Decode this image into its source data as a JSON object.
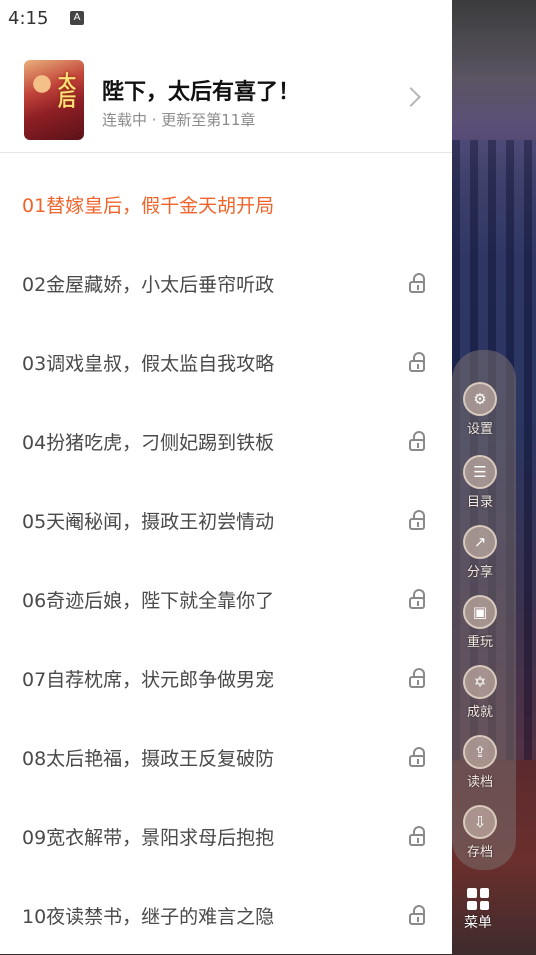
{
  "status_bar": {
    "time": "4:15",
    "notification_badge": "A"
  },
  "book": {
    "title": "陛下，太后有喜了！",
    "status": "连载中 · 更新至第11章"
  },
  "chapters": [
    {
      "title": "01替嫁皇后，假千金天胡开局",
      "locked": false,
      "active": true
    },
    {
      "title": "02金屋藏娇，小太后垂帘听政",
      "locked": true,
      "active": false
    },
    {
      "title": "03调戏皇叔，假太监自我攻略",
      "locked": true,
      "active": false
    },
    {
      "title": "04扮猪吃虎，刁侧妃踢到铁板",
      "locked": true,
      "active": false
    },
    {
      "title": "05天阉秘闻，摄政王初尝情动",
      "locked": true,
      "active": false
    },
    {
      "title": "06奇迹后娘，陛下就全靠你了",
      "locked": true,
      "active": false
    },
    {
      "title": "07自荐枕席，状元郎争做男宠",
      "locked": true,
      "active": false
    },
    {
      "title": "08太后艳福，摄政王反复破防",
      "locked": true,
      "active": false
    },
    {
      "title": "09宽衣解带，景阳求母后抱抱",
      "locked": true,
      "active": false
    },
    {
      "title": "10夜读禁书，继子的难言之隐",
      "locked": true,
      "active": false
    }
  ],
  "side_menu": {
    "items": [
      {
        "label": "设置",
        "icon": "gear-icon"
      },
      {
        "label": "目录",
        "icon": "list-icon"
      },
      {
        "label": "分享",
        "icon": "share-icon"
      },
      {
        "label": "重玩",
        "icon": "replay-icon"
      },
      {
        "label": "成就",
        "icon": "star-icon"
      },
      {
        "label": "读档",
        "icon": "load-icon"
      },
      {
        "label": "存档",
        "icon": "save-icon"
      }
    ],
    "menu_label": "菜单"
  },
  "colors": {
    "accent": "#f0642c",
    "text": "#4a4a4a",
    "muted": "#8c8c8c"
  }
}
